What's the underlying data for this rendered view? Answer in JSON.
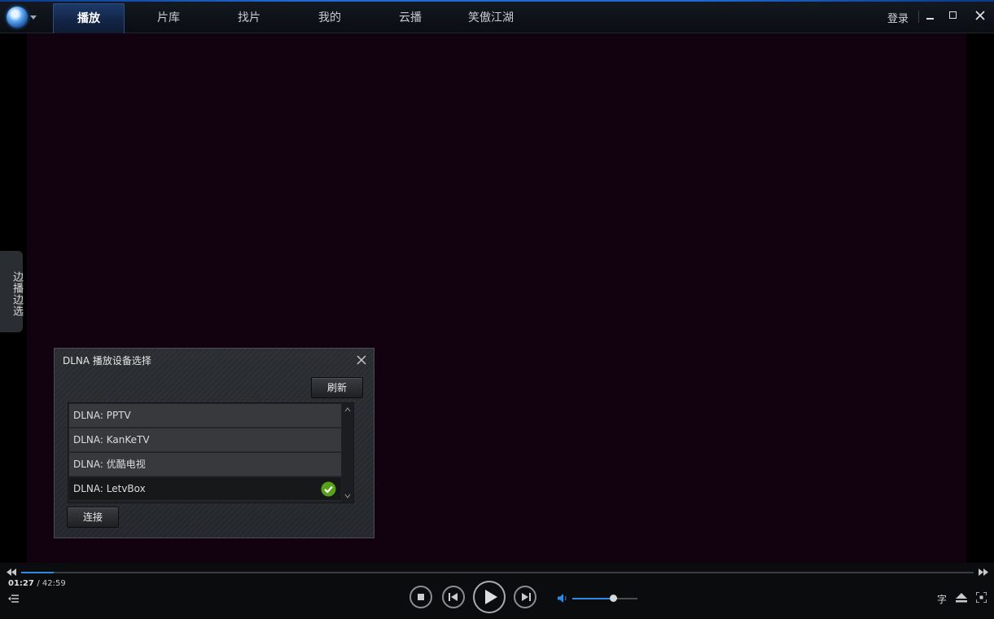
{
  "titlebar": {
    "tabs": [
      {
        "label": "播放",
        "active": true
      },
      {
        "label": "片库"
      },
      {
        "label": "找片"
      },
      {
        "label": "我的"
      },
      {
        "label": "云播"
      },
      {
        "label": "笑傲江湖"
      }
    ],
    "login": "登录",
    "accent": "#1f6ad8"
  },
  "side_tab": {
    "label": "边播边选"
  },
  "dlna_dialog": {
    "title": "DLNA 播放设备选择",
    "refresh_label": "刷新",
    "connect_label": "连接",
    "devices": [
      {
        "label": "DLNA: PPTV"
      },
      {
        "label": "DLNA: KanKeTV"
      },
      {
        "label": "DLNA: 优酷电视"
      },
      {
        "label": "DLNA: LetvBox",
        "selected": true
      }
    ]
  },
  "player": {
    "current_time": "01:27",
    "total_time": "/ 42:59",
    "progress_fraction": 0.034,
    "volume_fraction": 0.62,
    "subtitle_label": "字"
  }
}
